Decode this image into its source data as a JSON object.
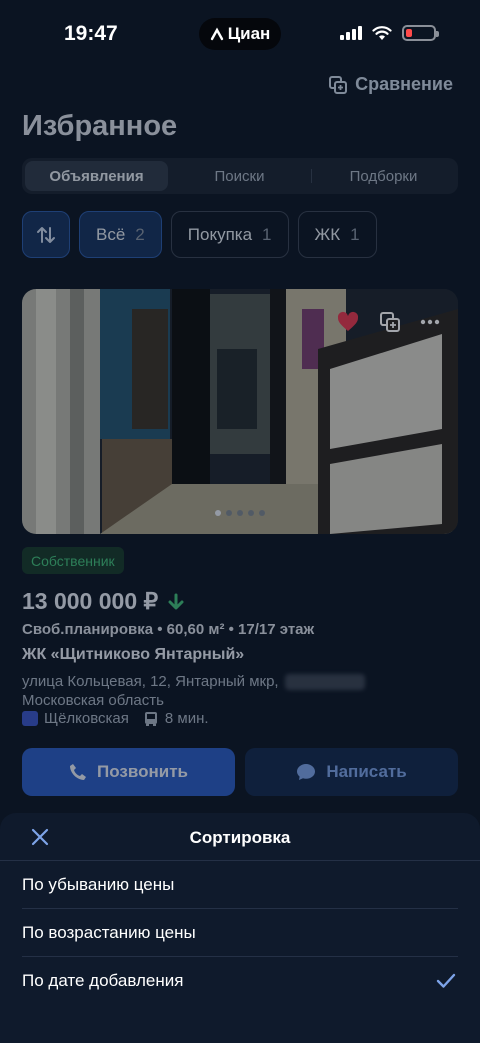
{
  "status_bar": {
    "time": "19:47",
    "brand": "Циан"
  },
  "header": {
    "compare_label": "Сравнение",
    "title": "Избранное"
  },
  "tabs": [
    {
      "label": "Объявления",
      "active": true
    },
    {
      "label": "Поиски",
      "active": false
    },
    {
      "label": "Подборки",
      "active": false
    }
  ],
  "filters": [
    {
      "label": "Всё",
      "count": "2",
      "selected": true
    },
    {
      "label": "Покупка",
      "count": "1",
      "selected": false
    },
    {
      "label": "ЖК",
      "count": "1",
      "selected": false
    }
  ],
  "listing": {
    "owner_badge": "Собственник",
    "price": "13 000 000 ₽",
    "details": "Своб.планировка • 60,60 м² • 17/17 этаж",
    "complex": "ЖК «Щитниково Янтарный»",
    "address_line1": "улица Кольцевая, 12, Янтарный мкр,",
    "address_line2": "Московская область",
    "metro_station": "Щёлковская",
    "metro_time": "8 мин.",
    "photo_count": 5,
    "photo_index": 1
  },
  "actions": {
    "call_label": "Позвонить",
    "write_label": "Написать"
  },
  "sort_sheet": {
    "title": "Сортировка",
    "options": [
      {
        "label": "По убыванию цены",
        "selected": false
      },
      {
        "label": "По возрастанию цены",
        "selected": false
      },
      {
        "label": "По дате добавления",
        "selected": true
      }
    ]
  },
  "colors": {
    "accent": "#2a5bc4",
    "check": "#7da3e8",
    "owner_badge": "#43c07a",
    "price_drop": "#43c07a"
  },
  "icons": {
    "sort": "sort-arrows-icon",
    "compare": "compare-icon",
    "favorite": "heart-icon",
    "more": "more-icon",
    "call": "phone-icon",
    "write": "chat-icon",
    "close": "close-icon",
    "check": "check-icon"
  }
}
